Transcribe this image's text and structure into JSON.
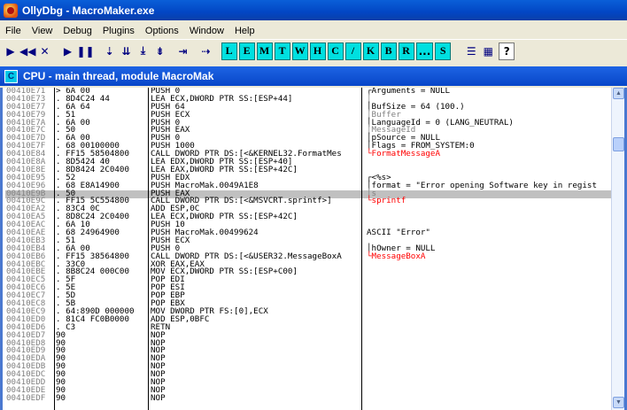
{
  "window": {
    "title": "OllyDbg - MacroMaker.exe"
  },
  "menu": [
    "File",
    "View",
    "Debug",
    "Plugins",
    "Options",
    "Window",
    "Help"
  ],
  "toolbar": {
    "buttons": [
      {
        "icon": "open-icon",
        "glyph": "▶"
      },
      {
        "icon": "restart-icon",
        "glyph": "◀◀"
      },
      {
        "icon": "close-icon",
        "glyph": "✕"
      },
      {
        "icon": "run-icon",
        "glyph": "▶"
      },
      {
        "icon": "pause-icon",
        "glyph": "❚❚"
      },
      {
        "icon": "step-into-icon",
        "glyph": "⇣"
      },
      {
        "icon": "step-over-icon",
        "glyph": "⇊"
      },
      {
        "icon": "trace-into-icon",
        "glyph": "⤓"
      },
      {
        "icon": "trace-over-icon",
        "glyph": "⇟"
      },
      {
        "icon": "execute-till-return-icon",
        "glyph": "⇥"
      },
      {
        "icon": "go-to-icon",
        "glyph": "⇢"
      }
    ],
    "letters": [
      "L",
      "E",
      "M",
      "T",
      "W",
      "H",
      "C",
      "/",
      "K",
      "B",
      "R",
      "...",
      "S"
    ],
    "view_icons": [
      {
        "icon": "list-icon",
        "glyph": "☰"
      },
      {
        "icon": "grid-icon",
        "glyph": "▦"
      },
      {
        "icon": "help-icon",
        "glyph": "?"
      }
    ]
  },
  "cpu_window": {
    "title": "CPU - main thread, module MacroMak",
    "icon_letter": "C"
  },
  "disasm": {
    "addresses": [
      "00410E71",
      "00410E73",
      "00410E77",
      "00410E79",
      "00410E7A",
      "00410E7C",
      "00410E7D",
      "00410E7F",
      "00410E84",
      "00410E8A",
      "00410E8E",
      "00410E95",
      "00410E96",
      "00410E9B",
      "00410E9C",
      "00410EA2",
      "00410EA5",
      "00410EAC",
      "00410EAE",
      "00410EB3",
      "00410EB4",
      "00410EB6",
      "00410EBC",
      "00410EBE",
      "00410EC5",
      "00410EC6",
      "00410EC7",
      "00410EC8",
      "00410EC9",
      "00410ED0",
      "00410ED6",
      "00410ED7",
      "00410ED8",
      "00410ED9",
      "00410EDA",
      "00410EDB",
      "00410EDC",
      "00410EDD",
      "00410EDE",
      "00410EDF"
    ],
    "hex": [
      "> 6A 00",
      ". 8D4C24 44",
      ". 6A 64",
      ". 51",
      ". 6A 00",
      ". 50",
      ". 6A 00",
      ". 68 00100000",
      ". FF15 58504800",
      ". 8D5424 40",
      ". 8D8424 2C0400",
      ". 52",
      ". 68 E8A14900",
      ". 50",
      ". FF15 5C554800",
      ". 83C4 0C",
      ". 8D8C24 2C0400",
      ". 6A 10",
      ". 68 24964900",
      ". 51",
      ". 6A 00",
      ". FF15 38564800",
      ". 33C0",
      ". 8B8C24 000C00",
      ". 5F",
      ". 5E",
      ". 5D",
      ". 5B",
      ". 64:890D 000000",
      ". 81C4 FC0B0000",
      ". C3",
      "90",
      "90",
      "90",
      "90",
      "90",
      "90",
      "90",
      "90",
      "90"
    ],
    "instructions": [
      "PUSH 0",
      "LEA ECX,DWORD PTR SS:[ESP+44]",
      "PUSH 64",
      "PUSH ECX",
      "PUSH 0",
      "PUSH EAX",
      "PUSH 0",
      "PUSH 1000",
      "CALL DWORD PTR DS:[<&KERNEL32.FormatMes",
      "LEA EDX,DWORD PTR SS:[ESP+40]",
      "LEA EAX,DWORD PTR SS:[ESP+42C]",
      "PUSH EDX",
      "PUSH MacroMak.0049A1E8",
      "PUSH EAX",
      "CALL DWORD PTR DS:[<&MSVCRT.sprintf>]",
      "ADD ESP,0C",
      "LEA ECX,DWORD PTR SS:[ESP+42C]",
      "PUSH 10",
      "PUSH MacroMak.00499624",
      "PUSH ECX",
      "PUSH 0",
      "CALL DWORD PTR DS:[<&USER32.MessageBoxA",
      "XOR EAX,EAX",
      "MOV ECX,DWORD PTR SS:[ESP+C00]",
      "POP EDI",
      "POP ESI",
      "POP EBP",
      "POP EBX",
      "MOV DWORD PTR FS:[0],ECX",
      "ADD ESP,0BFC",
      "RETN",
      "NOP",
      "NOP",
      "NOP",
      "NOP",
      "NOP",
      "NOP",
      "NOP",
      "NOP",
      "NOP"
    ],
    "comments": [
      "┌Arguments = NULL",
      "│",
      "│BufSize = 64 (100.)",
      "│Buffer",
      "│LanguageId = 0 (LANG_NEUTRAL)",
      "│MessageId",
      "│pSource = NULL",
      "│Flags = FROM_SYSTEM:0",
      "└FormatMessageA",
      "",
      "",
      "┌<%s>",
      "│format = \"Error opening Software key in regist",
      "│s",
      "└sprintf",
      "",
      "",
      "",
      "ASCII \"Error\"",
      "",
      "│hOwner = NULL",
      "└MessageBoxA",
      "",
      "",
      "",
      "",
      "",
      "",
      "",
      "",
      "",
      "",
      "",
      "",
      "",
      "",
      "",
      "",
      "",
      ""
    ],
    "comment_styles": [
      "",
      "gray",
      "",
      "gray",
      "",
      "gray",
      "",
      "",
      "red",
      "",
      "",
      "",
      "",
      "gray",
      "red",
      "",
      "",
      "",
      "",
      "",
      "",
      "red",
      "",
      "",
      "",
      "",
      "",
      "",
      "",
      "",
      "",
      "",
      "",
      "",
      "",
      "",
      "",
      "",
      "",
      ""
    ]
  },
  "colors": {
    "title_blue": "#0246c4",
    "toolbar_letter_bg": "#00e0e0",
    "selection_gray": "#c0c0c0",
    "api_red": "#ff0000"
  }
}
